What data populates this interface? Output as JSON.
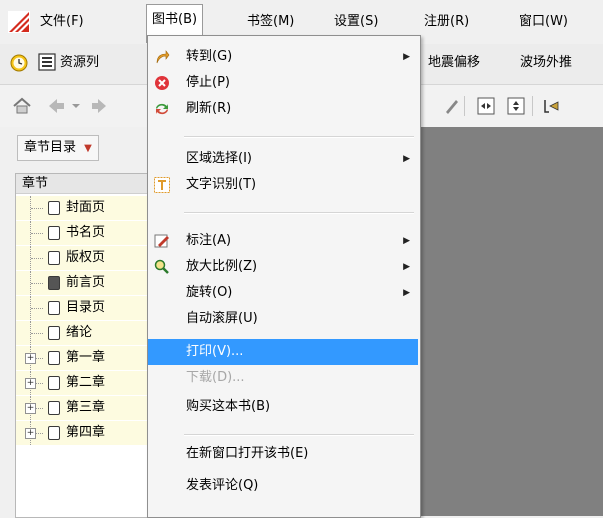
{
  "menubar": {
    "items": [
      {
        "label": "文件(F)"
      },
      {
        "label": "图书(B)"
      },
      {
        "label": "书签(M)"
      },
      {
        "label": "设置(S)"
      },
      {
        "label": "注册(R)"
      },
      {
        "label": "窗口(W)"
      }
    ]
  },
  "tabs": {
    "resource_tab": "资源列",
    "open_tabs": [
      "地震偏移",
      "波场外推"
    ]
  },
  "left_pane": {
    "toc_dropdown": "章节目录",
    "tree_header": "章节",
    "items": [
      {
        "label": "封面页",
        "expandable": false
      },
      {
        "label": "书名页",
        "expandable": false
      },
      {
        "label": "版权页",
        "expandable": false
      },
      {
        "label": "前言页",
        "expandable": false
      },
      {
        "label": "目录页",
        "expandable": false
      },
      {
        "label": "绪论",
        "expandable": false
      },
      {
        "label": "第一章",
        "expandable": true
      },
      {
        "label": "第二章",
        "expandable": true
      },
      {
        "label": "第三章",
        "expandable": true
      },
      {
        "label": "第四章",
        "expandable": true
      }
    ]
  },
  "book_menu": {
    "items": [
      {
        "label": "转到(G)",
        "icon": "goto-arrow-icon",
        "submenu": true
      },
      {
        "label": "停止(P)",
        "icon": "stop-icon",
        "submenu": false
      },
      {
        "label": "刷新(R)",
        "icon": "refresh-icon",
        "submenu": false
      },
      {
        "label": "区域选择(I)",
        "icon": "",
        "submenu": true
      },
      {
        "label": "文字识别(T)",
        "icon": "text-ocr-icon",
        "submenu": false
      },
      {
        "label": "标注(A)",
        "icon": "annotate-icon",
        "submenu": true
      },
      {
        "label": "放大比例(Z)",
        "icon": "zoom-icon",
        "submenu": true
      },
      {
        "label": "旋转(O)",
        "icon": "",
        "submenu": true
      },
      {
        "label": "自动滚屏(U)",
        "icon": "",
        "submenu": false
      },
      {
        "label": "打印(V)...",
        "icon": "",
        "submenu": false,
        "highlighted": true
      },
      {
        "label": "下载(D)...",
        "icon": "",
        "submenu": false,
        "disabled": true
      },
      {
        "label": "购买这本书(B)",
        "icon": "",
        "submenu": false
      },
      {
        "label": "在新窗口打开该书(E)",
        "icon": "",
        "submenu": false
      },
      {
        "label": "发表评论(Q)",
        "icon": "",
        "submenu": false
      }
    ]
  },
  "colors": {
    "highlight": "#3399ff",
    "doc_background": "#808080",
    "tree_highlight": "#fdfbe0"
  }
}
